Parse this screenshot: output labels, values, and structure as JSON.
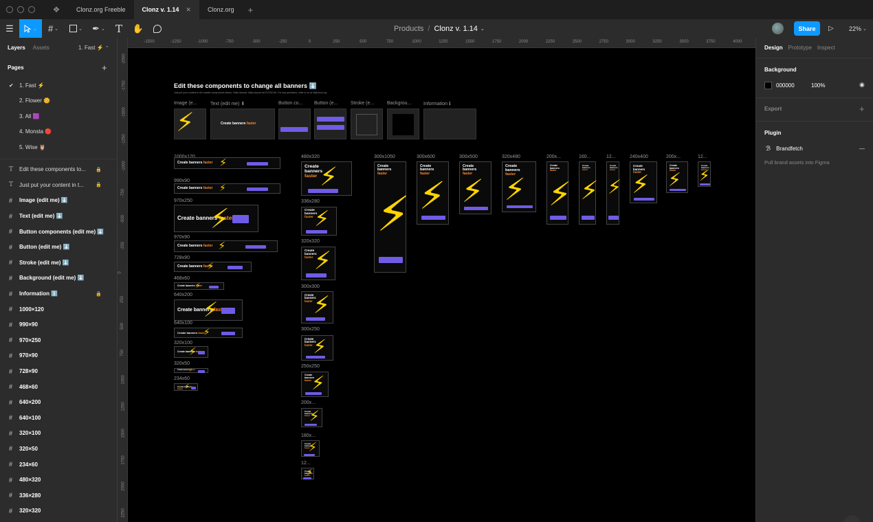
{
  "tabs": [
    {
      "label": "Clonz.org Freeble"
    },
    {
      "label": "Clonz v. 1.14",
      "active": true
    },
    {
      "label": "Clonz.org"
    }
  ],
  "toolbar": {
    "breadcrumb_project": "Products",
    "breadcrumb_sep": "/",
    "breadcrumb_file": "Clonz v. 1.14",
    "share_label": "Share",
    "zoom": "22%"
  },
  "left_panel": {
    "tab_layers": "Layers",
    "tab_assets": "Assets",
    "current_page": "1. Fast ⚡",
    "pages_header": "Pages",
    "pages": [
      "1. Fast ⚡",
      "2. Flower 🌼",
      "3. All 🟪",
      "4. Monsta 🔴",
      "5. Wise 🦉"
    ],
    "layers": [
      {
        "name": "Edit these components to...",
        "icon": "text-icon",
        "locked": true
      },
      {
        "name": "Just put your content in t...",
        "icon": "text-icon",
        "locked": true
      },
      {
        "name": "Image (edit me) ⬇️",
        "icon": "frame-icon",
        "bold": true
      },
      {
        "name": "Text (edit me) ⬇️",
        "icon": "frame-icon",
        "bold": true
      },
      {
        "name": "Button components (edit me) ⬇️",
        "icon": "frame-icon",
        "bold": true
      },
      {
        "name": "Button (edit me) ⬇️",
        "icon": "frame-icon",
        "bold": true
      },
      {
        "name": "Stroke (edit me) ⬇️",
        "icon": "frame-icon",
        "bold": true
      },
      {
        "name": "Background (edit me) ⬇️",
        "icon": "frame-icon",
        "bold": true
      },
      {
        "name": "Information ℹ️",
        "icon": "frame-icon",
        "bold": true,
        "locked": true
      },
      {
        "name": "1000×120",
        "icon": "frame-icon",
        "bold": true
      },
      {
        "name": "990×90",
        "icon": "frame-icon",
        "bold": true
      },
      {
        "name": "970×250",
        "icon": "frame-icon",
        "bold": true
      },
      {
        "name": "970×90",
        "icon": "frame-icon",
        "bold": true
      },
      {
        "name": "728×90",
        "icon": "frame-icon",
        "bold": true
      },
      {
        "name": "468×60",
        "icon": "frame-icon",
        "bold": true
      },
      {
        "name": "640×200",
        "icon": "frame-icon",
        "bold": true
      },
      {
        "name": "640×100",
        "icon": "frame-icon",
        "bold": true
      },
      {
        "name": "320×100",
        "icon": "frame-icon",
        "bold": true
      },
      {
        "name": "320×50",
        "icon": "frame-icon",
        "bold": true
      },
      {
        "name": "234×60",
        "icon": "frame-icon",
        "bold": true
      },
      {
        "name": "480×320",
        "icon": "frame-icon",
        "bold": true
      },
      {
        "name": "336×280",
        "icon": "frame-icon",
        "bold": true
      },
      {
        "name": "320×320",
        "icon": "frame-icon",
        "bold": true
      }
    ]
  },
  "rulers": {
    "h": [
      "-1500",
      "-1250",
      "-1000",
      "-750",
      "-500",
      "-250",
      "0",
      "250",
      "500",
      "750",
      "1000",
      "1250",
      "1500",
      "1750",
      "2000",
      "2250",
      "2500",
      "2750",
      "3000",
      "3250",
      "3500",
      "3750",
      "4000"
    ],
    "v": [
      "-2000",
      "-1750",
      "-1500",
      "-1250",
      "-1000",
      "-750",
      "-500",
      "-250",
      "0",
      "250",
      "500",
      "750",
      "1000",
      "1250",
      "1500",
      "1750",
      "2000",
      "2250"
    ]
  },
  "canvas": {
    "title": "Edit these components to change all banners ⬇️",
    "subtitle": "Just put your content in the master components below. Video tutorial: https://youtu.be/7127kCHh. For any questions, write to us at hi@clonz.org",
    "components": [
      "Image (e...",
      "Text (edit me) ⬇",
      "Button co...",
      "Button (e...",
      "Stroke (e...",
      "Backgrou...",
      "Information ℹ"
    ],
    "banner_text": "Create banners",
    "banner_accent": "faster",
    "button_text": "Get started free",
    "bolt": "⚡",
    "col1": [
      "1000x120",
      "990x90",
      "970x250",
      "970x90",
      "728x90",
      "468x60",
      "640x200",
      "640x100",
      "320x100",
      "320x50",
      "234x60"
    ],
    "col2": [
      "480x320",
      "336x280",
      "320x320",
      "300x300",
      "300x250",
      "250x250",
      "200x...",
      "180x...",
      "12..."
    ],
    "row_top": [
      "300x1050",
      "300x600",
      "300x500",
      "320x480",
      "200x...",
      "160...",
      "12...",
      "240x400",
      "200x...",
      "12..."
    ]
  },
  "right_panel": {
    "tab_design": "Design",
    "tab_prototype": "Prototype",
    "tab_inspect": "Inspect",
    "background_label": "Background",
    "bg_hex": "000000",
    "bg_opacity": "100%",
    "export_label": "Export",
    "plugin_label": "Plugin",
    "plugin_name": "Brandfetch",
    "plugin_desc": "Pull brand assets into Figma"
  },
  "colors": {
    "accent": "#0d99ff",
    "button": "#6e5ce6",
    "bolt": "#ffd400",
    "highlight": "#ff8c2a"
  }
}
